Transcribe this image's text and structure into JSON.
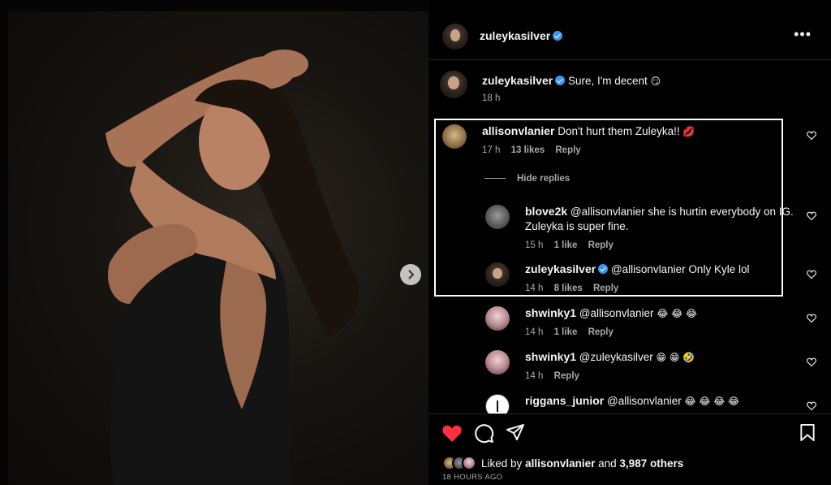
{
  "post": {
    "author": "zuleykasilver",
    "more_label": "•••",
    "liked_by_prefix": "Liked by",
    "liked_by_user": "allisonvlanier",
    "liked_by_and": "and",
    "liked_by_count": "3,987 others",
    "timestamp": "18 HOURS AGO"
  },
  "caption": {
    "author": "zuleykasilver",
    "text": "Sure, I'm decent",
    "emoji": "😏",
    "time": "18 h"
  },
  "comments": [
    {
      "author": "allisonvlanier",
      "text": "Don't hurt them Zuleyka!!",
      "emoji": "💋",
      "time": "17 h",
      "likes": "13 likes",
      "reply": "Reply"
    },
    {
      "author": "blove2k",
      "text": "@allisonvlanier she is hurtin everybody on IG. Zuleyka is super fine.",
      "time": "15 h",
      "likes": "1 like",
      "reply": "Reply"
    },
    {
      "author": "zuleykasilver",
      "text": "@allisonvlanier Only Kyle lol",
      "time": "14 h",
      "likes": "8 likes",
      "reply": "Reply"
    },
    {
      "author": "shwinky1",
      "text": "@allisonvlanier",
      "emoji": "😂 😂 😂",
      "time": "14 h",
      "likes": "1 like",
      "reply": "Reply"
    },
    {
      "author": "shwinky1",
      "text": "@zuleykasilver",
      "emoji": "😁 😁 🤣",
      "time": "14 h",
      "reply": "Reply"
    },
    {
      "author": "riggans_junior",
      "text": "@allisonvlanier",
      "emoji": "😂 😂 😂 😂"
    }
  ],
  "hide_replies_label": "Hide replies",
  "colors": {
    "verified": "#3897f0",
    "like_red": "#ff3040",
    "muted": "#a8a8a8"
  }
}
